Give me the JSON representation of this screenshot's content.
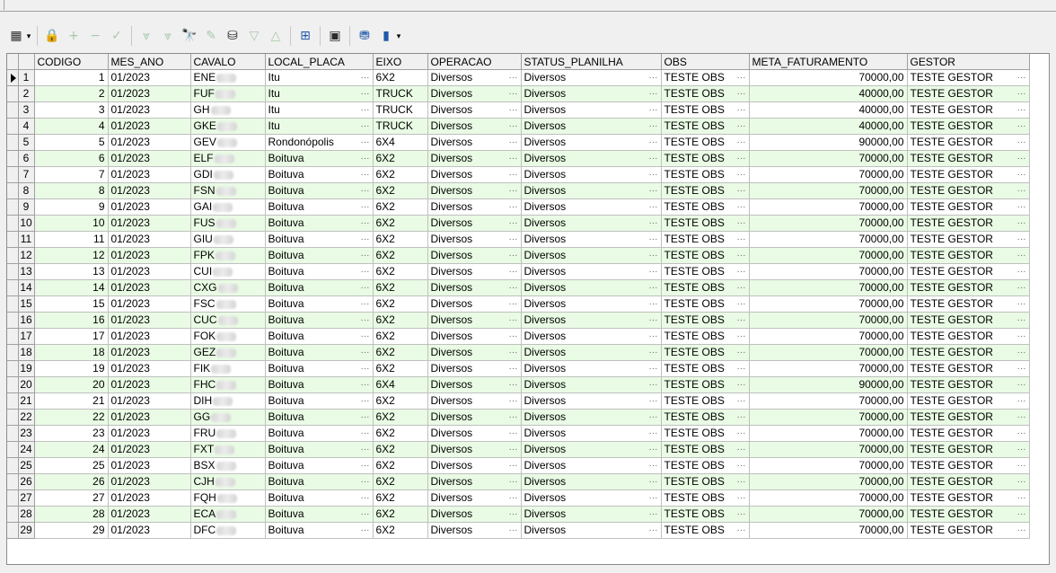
{
  "toolbar": {
    "buttons": [
      {
        "name": "grid-options-icon",
        "glyph": "▦"
      },
      {
        "name": "lock-icon",
        "glyph": "🔒"
      },
      {
        "name": "add-record-icon",
        "glyph": "+"
      },
      {
        "name": "delete-record-icon",
        "glyph": "−"
      },
      {
        "name": "confirm-icon",
        "glyph": "✓"
      },
      {
        "name": "filter-icon",
        "glyph": "⩔"
      },
      {
        "name": "filter-clear-icon",
        "glyph": "⩔"
      },
      {
        "name": "binoculars-icon",
        "glyph": "🔭"
      },
      {
        "name": "eraser-icon",
        "glyph": "✎"
      },
      {
        "name": "database-icon",
        "glyph": "⛁"
      },
      {
        "name": "sort-desc-icon",
        "glyph": "▽"
      },
      {
        "name": "sort-asc-icon",
        "glyph": "△"
      },
      {
        "name": "tree-icon",
        "glyph": "⊞"
      },
      {
        "name": "save-icon",
        "glyph": "▣"
      },
      {
        "name": "database-stack-icon",
        "glyph": "⛃"
      },
      {
        "name": "chart-icon",
        "glyph": "▮"
      }
    ],
    "colors": {
      "disabled": "#a9c9a9",
      "normal": "#2b2b2b",
      "accent": "#1e5aa8"
    }
  },
  "grid": {
    "columns": [
      "CODIGO",
      "MES_ANO",
      "CAVALO",
      "LOCAL_PLACA",
      "EIXO",
      "OPERACAO",
      "STATUS_PLANILHA",
      "OBS",
      "META_FATURAMENTO",
      "GESTOR"
    ],
    "alt_row_color": "#e9fbe4",
    "rows": [
      {
        "n": "1",
        "codigo": "1",
        "mes": "01/2023",
        "cavalo": "ENE",
        "local": "Itu",
        "eixo": "6X2",
        "op": "Diversos",
        "status": "Diversos",
        "obs": "TESTE OBS",
        "meta": "70000,00",
        "gestor": "TESTE GESTOR"
      },
      {
        "n": "2",
        "codigo": "2",
        "mes": "01/2023",
        "cavalo": "FUF",
        "local": "Itu",
        "eixo": "TRUCK",
        "op": "Diversos",
        "status": "Diversos",
        "obs": "TESTE OBS",
        "meta": "40000,00",
        "gestor": "TESTE GESTOR"
      },
      {
        "n": "3",
        "codigo": "3",
        "mes": "01/2023",
        "cavalo": "GH",
        "local": "Itu",
        "eixo": "TRUCK",
        "op": "Diversos",
        "status": "Diversos",
        "obs": "TESTE OBS",
        "meta": "40000,00",
        "gestor": "TESTE GESTOR"
      },
      {
        "n": "4",
        "codigo": "4",
        "mes": "01/2023",
        "cavalo": "GKE",
        "local": "Itu",
        "eixo": "TRUCK",
        "op": "Diversos",
        "status": "Diversos",
        "obs": "TESTE OBS",
        "meta": "40000,00",
        "gestor": "TESTE GESTOR"
      },
      {
        "n": "5",
        "codigo": "5",
        "mes": "01/2023",
        "cavalo": "GEV",
        "local": "Rondonópolis",
        "eixo": "6X4",
        "op": "Diversos",
        "status": "Diversos",
        "obs": "TESTE OBS",
        "meta": "90000,00",
        "gestor": "TESTE GESTOR"
      },
      {
        "n": "6",
        "codigo": "6",
        "mes": "01/2023",
        "cavalo": "ELF",
        "local": "Boituva",
        "eixo": "6X2",
        "op": "Diversos",
        "status": "Diversos",
        "obs": "TESTE OBS",
        "meta": "70000,00",
        "gestor": "TESTE GESTOR"
      },
      {
        "n": "7",
        "codigo": "7",
        "mes": "01/2023",
        "cavalo": "GDI",
        "local": "Boituva",
        "eixo": "6X2",
        "op": "Diversos",
        "status": "Diversos",
        "obs": "TESTE OBS",
        "meta": "70000,00",
        "gestor": "TESTE GESTOR"
      },
      {
        "n": "8",
        "codigo": "8",
        "mes": "01/2023",
        "cavalo": "FSN",
        "local": "Boituva",
        "eixo": "6X2",
        "op": "Diversos",
        "status": "Diversos",
        "obs": "TESTE OBS",
        "meta": "70000,00",
        "gestor": "TESTE GESTOR"
      },
      {
        "n": "9",
        "codigo": "9",
        "mes": "01/2023",
        "cavalo": "GAI",
        "local": "Boituva",
        "eixo": "6X2",
        "op": "Diversos",
        "status": "Diversos",
        "obs": "TESTE OBS",
        "meta": "70000,00",
        "gestor": "TESTE GESTOR"
      },
      {
        "n": "10",
        "codigo": "10",
        "mes": "01/2023",
        "cavalo": "FUS",
        "local": "Boituva",
        "eixo": "6X2",
        "op": "Diversos",
        "status": "Diversos",
        "obs": "TESTE OBS",
        "meta": "70000,00",
        "gestor": "TESTE GESTOR"
      },
      {
        "n": "11",
        "codigo": "11",
        "mes": "01/2023",
        "cavalo": "GIU",
        "local": "Boituva",
        "eixo": "6X2",
        "op": "Diversos",
        "status": "Diversos",
        "obs": "TESTE OBS",
        "meta": "70000,00",
        "gestor": "TESTE GESTOR"
      },
      {
        "n": "12",
        "codigo": "12",
        "mes": "01/2023",
        "cavalo": "FPK",
        "local": "Boituva",
        "eixo": "6X2",
        "op": "Diversos",
        "status": "Diversos",
        "obs": "TESTE OBS",
        "meta": "70000,00",
        "gestor": "TESTE GESTOR"
      },
      {
        "n": "13",
        "codigo": "13",
        "mes": "01/2023",
        "cavalo": "CUI",
        "local": "Boituva",
        "eixo": "6X2",
        "op": "Diversos",
        "status": "Diversos",
        "obs": "TESTE OBS",
        "meta": "70000,00",
        "gestor": "TESTE GESTOR"
      },
      {
        "n": "14",
        "codigo": "14",
        "mes": "01/2023",
        "cavalo": "CXG",
        "local": "Boituva",
        "eixo": "6X2",
        "op": "Diversos",
        "status": "Diversos",
        "obs": "TESTE OBS",
        "meta": "70000,00",
        "gestor": "TESTE GESTOR"
      },
      {
        "n": "15",
        "codigo": "15",
        "mes": "01/2023",
        "cavalo": "FSC",
        "local": "Boituva",
        "eixo": "6X2",
        "op": "Diversos",
        "status": "Diversos",
        "obs": "TESTE OBS",
        "meta": "70000,00",
        "gestor": "TESTE GESTOR"
      },
      {
        "n": "16",
        "codigo": "16",
        "mes": "01/2023",
        "cavalo": "CUC",
        "local": "Boituva",
        "eixo": "6X2",
        "op": "Diversos",
        "status": "Diversos",
        "obs": "TESTE OBS",
        "meta": "70000,00",
        "gestor": "TESTE GESTOR"
      },
      {
        "n": "17",
        "codigo": "17",
        "mes": "01/2023",
        "cavalo": "FOK",
        "local": "Boituva",
        "eixo": "6X2",
        "op": "Diversos",
        "status": "Diversos",
        "obs": "TESTE OBS",
        "meta": "70000,00",
        "gestor": "TESTE GESTOR"
      },
      {
        "n": "18",
        "codigo": "18",
        "mes": "01/2023",
        "cavalo": "GEZ",
        "local": "Boituva",
        "eixo": "6X2",
        "op": "Diversos",
        "status": "Diversos",
        "obs": "TESTE OBS",
        "meta": "70000,00",
        "gestor": "TESTE GESTOR"
      },
      {
        "n": "19",
        "codigo": "19",
        "mes": "01/2023",
        "cavalo": "FIK",
        "local": "Boituva",
        "eixo": "6X2",
        "op": "Diversos",
        "status": "Diversos",
        "obs": "TESTE OBS",
        "meta": "70000,00",
        "gestor": "TESTE GESTOR"
      },
      {
        "n": "20",
        "codigo": "20",
        "mes": "01/2023",
        "cavalo": "FHC",
        "local": "Boituva",
        "eixo": "6X4",
        "op": "Diversos",
        "status": "Diversos",
        "obs": "TESTE OBS",
        "meta": "90000,00",
        "gestor": "TESTE GESTOR"
      },
      {
        "n": "21",
        "codigo": "21",
        "mes": "01/2023",
        "cavalo": "DIH",
        "local": "Boituva",
        "eixo": "6X2",
        "op": "Diversos",
        "status": "Diversos",
        "obs": "TESTE OBS",
        "meta": "70000,00",
        "gestor": "TESTE GESTOR"
      },
      {
        "n": "22",
        "codigo": "22",
        "mes": "01/2023",
        "cavalo": "GG",
        "local": "Boituva",
        "eixo": "6X2",
        "op": "Diversos",
        "status": "Diversos",
        "obs": "TESTE OBS",
        "meta": "70000,00",
        "gestor": "TESTE GESTOR"
      },
      {
        "n": "23",
        "codigo": "23",
        "mes": "01/2023",
        "cavalo": "FRU",
        "local": "Boituva",
        "eixo": "6X2",
        "op": "Diversos",
        "status": "Diversos",
        "obs": "TESTE OBS",
        "meta": "70000,00",
        "gestor": "TESTE GESTOR"
      },
      {
        "n": "24",
        "codigo": "24",
        "mes": "01/2023",
        "cavalo": "FXT",
        "local": "Boituva",
        "eixo": "6X2",
        "op": "Diversos",
        "status": "Diversos",
        "obs": "TESTE OBS",
        "meta": "70000,00",
        "gestor": "TESTE GESTOR"
      },
      {
        "n": "25",
        "codigo": "25",
        "mes": "01/2023",
        "cavalo": "BSX",
        "local": "Boituva",
        "eixo": "6X2",
        "op": "Diversos",
        "status": "Diversos",
        "obs": "TESTE OBS",
        "meta": "70000,00",
        "gestor": "TESTE GESTOR"
      },
      {
        "n": "26",
        "codigo": "26",
        "mes": "01/2023",
        "cavalo": "CJH",
        "local": "Boituva",
        "eixo": "6X2",
        "op": "Diversos",
        "status": "Diversos",
        "obs": "TESTE OBS",
        "meta": "70000,00",
        "gestor": "TESTE GESTOR"
      },
      {
        "n": "27",
        "codigo": "27",
        "mes": "01/2023",
        "cavalo": "FQH",
        "local": "Boituva",
        "eixo": "6X2",
        "op": "Diversos",
        "status": "Diversos",
        "obs": "TESTE OBS",
        "meta": "70000,00",
        "gestor": "TESTE GESTOR"
      },
      {
        "n": "28",
        "codigo": "28",
        "mes": "01/2023",
        "cavalo": "ECA",
        "local": "Boituva",
        "eixo": "6X2",
        "op": "Diversos",
        "status": "Diversos",
        "obs": "TESTE OBS",
        "meta": "70000,00",
        "gestor": "TESTE GESTOR"
      },
      {
        "n": "29",
        "codigo": "29",
        "mes": "01/2023",
        "cavalo": "DFC",
        "local": "Boituva",
        "eixo": "6X2",
        "op": "Diversos",
        "status": "Diversos",
        "obs": "TESTE OBS",
        "meta": "70000,00",
        "gestor": "TESTE GESTOR"
      }
    ]
  }
}
